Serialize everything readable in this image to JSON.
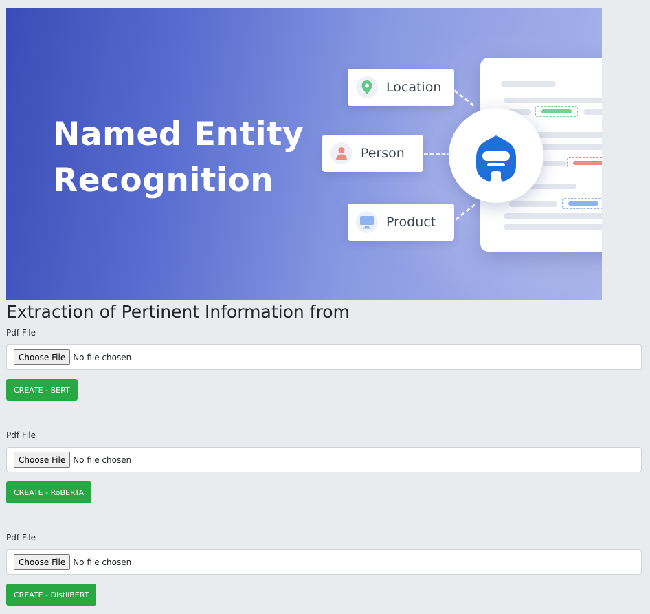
{
  "banner": {
    "title_line1": "Named Entity",
    "title_line2": "Recognition",
    "chips": {
      "location": {
        "label": "Location",
        "icon": "location-pin-icon"
      },
      "person": {
        "label": "Person",
        "icon": "person-icon"
      },
      "product": {
        "label": "Product",
        "icon": "monitor-icon"
      }
    },
    "center_icon": "bot-face-icon"
  },
  "page": {
    "heading": "Extraction of Pertinent Information from"
  },
  "forms": [
    {
      "label": "Pdf File",
      "choose_label": "Choose File",
      "file_status": "No file chosen",
      "button_label": "CREATE - BERT"
    },
    {
      "label": "Pdf File",
      "choose_label": "Choose File",
      "file_status": "No file chosen",
      "button_label": "CREATE - RoBERTA"
    },
    {
      "label": "Pdf File",
      "choose_label": "Choose File",
      "file_status": "No file chosen",
      "button_label": "CREATE - DistilBERT"
    }
  ],
  "colors": {
    "button_green": "#28a745",
    "page_background": "#e9ecef",
    "banner_blue": "#3a4cb8",
    "tag_green": "#6fd68f",
    "tag_red": "#f08a80",
    "tag_blue": "#8fb2f0"
  }
}
